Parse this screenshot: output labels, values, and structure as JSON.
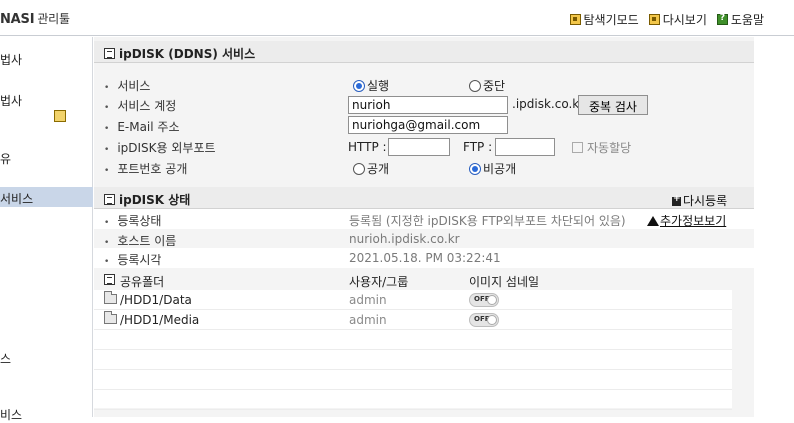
{
  "header": {
    "app_title": "NASI",
    "app_subtitle": "관리툴",
    "links": [
      {
        "label": "탐색기모드",
        "icon": "explorer-icon"
      },
      {
        "label": "다시보기",
        "icon": "refresh-icon"
      },
      {
        "label": "도움말",
        "icon": "help-icon"
      }
    ]
  },
  "sidebar": {
    "items": [
      "법사",
      "법사",
      "유",
      "서비스",
      "스",
      "비스"
    ]
  },
  "ddns": {
    "title": "ipDISK (DDNS) 서비스",
    "service_label": "서비스",
    "run_label": "실행",
    "stop_label": "중단",
    "account_label": "서비스 계정",
    "account_value": "nurioh",
    "domain_suffix": ".ipdisk.co.kr",
    "dup_check_label": "중복 검사",
    "email_label": "E-Mail 주소",
    "email_value": "nuriohga@gmail.com",
    "port_label": "ipDISK용 외부포트",
    "http_label": "HTTP :",
    "http_value": "",
    "ftp_label": "FTP :",
    "ftp_value": "",
    "auto_assign_label": "자동할당",
    "port_public_label": "포트번호 공개",
    "public_label": "공개",
    "private_label": "비공개"
  },
  "status": {
    "title": "ipDISK 상태",
    "reregister_label": "다시등록",
    "reg_state_label": "등록상태",
    "reg_state_value": "등록됨 (지정한 ipDISK용 FTP외부포트 차단되어 있음)",
    "more_info_label": "추가정보보기",
    "host_label": "호스트 이름",
    "host_value": "nurioh.ipdisk.co.kr",
    "reg_time_label": "등록시각",
    "reg_time_value": "2021.05.18. PM 03:22:41"
  },
  "shares": {
    "col_folder": "공유폴더",
    "col_user": "사용자/그룹",
    "col_thumb": "이미지 섬네일",
    "toggle_label": "OFF",
    "rows": [
      {
        "folder": "/HDD1/Data",
        "user": "admin",
        "thumbnail": "OFF"
      },
      {
        "folder": "/HDD1/Media",
        "user": "admin",
        "thumbnail": "OFF"
      }
    ]
  },
  "colors": {
    "accent": "#2a6ad8",
    "sidebar_active": "#c9d6e8",
    "section_bg": "#ececec"
  }
}
